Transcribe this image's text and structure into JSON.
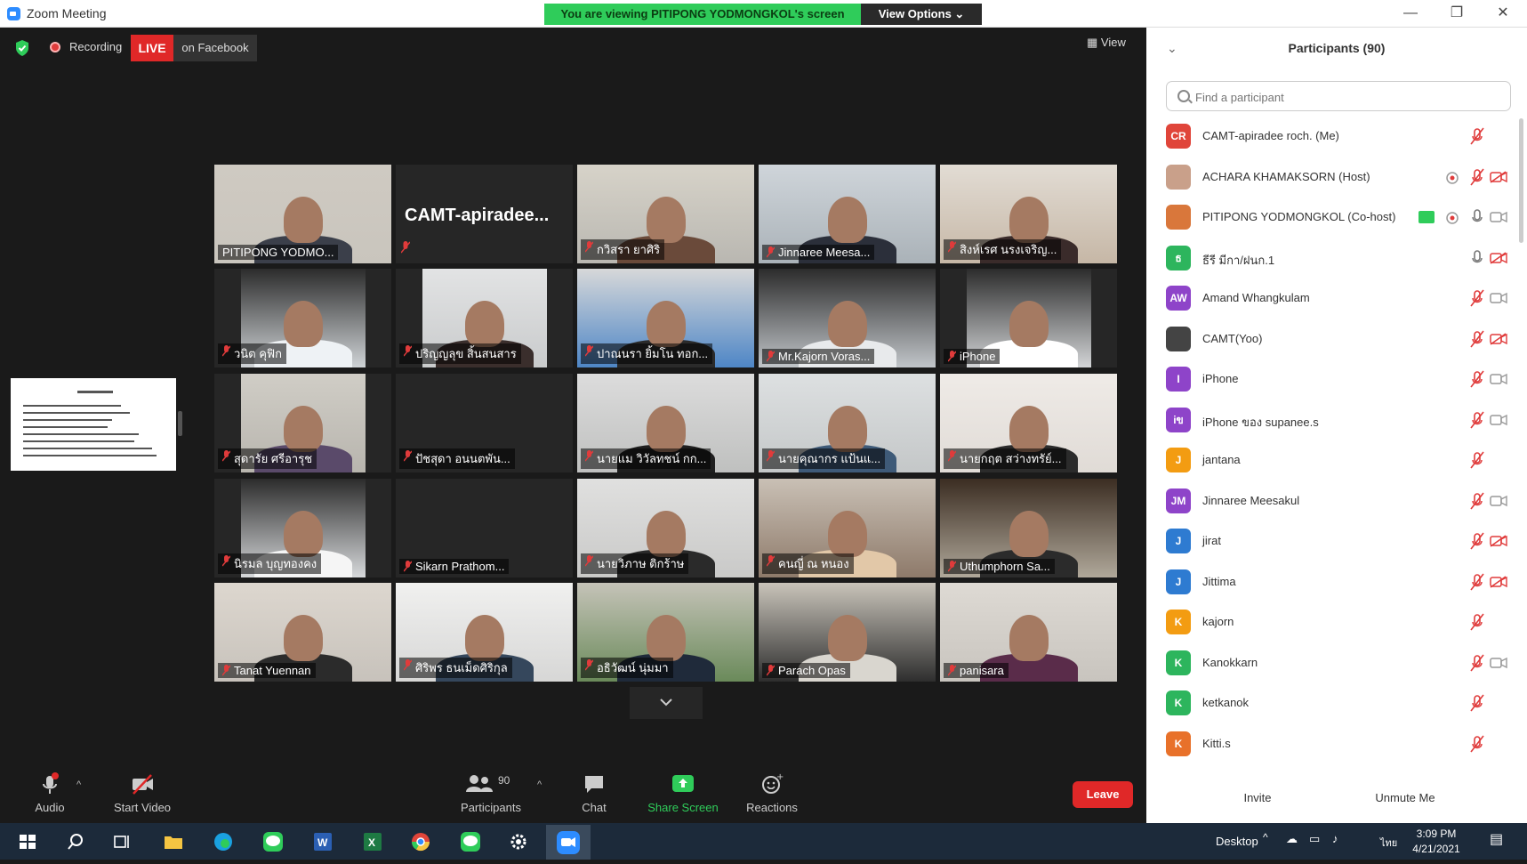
{
  "window": {
    "title": "Zoom Meeting",
    "viewing_banner": "You are viewing PITIPONG YODMONGKOL's screen",
    "view_options": "View Options ⌄",
    "minimize": "—",
    "restore": "❐",
    "close": "✕"
  },
  "topbar": {
    "recording": "Recording",
    "live": "LIVE",
    "live_on": "on Facebook",
    "view": "View"
  },
  "tiles": [
    {
      "name": "PITIPONG YODMO..."
    },
    {
      "name": "CAMT-apiradee..."
    },
    {
      "name": "กวิสรา ยาศิริ"
    },
    {
      "name": "Jinnaree Meesa..."
    },
    {
      "name": "สิงห์เรศ นรงเจริญ..."
    },
    {
      "name": "วนิต คุฟิก"
    },
    {
      "name": "ปริญญลุข สิ้นสนสาร"
    },
    {
      "name": "ปาณนรา ยิ้มโน ทอก..."
    },
    {
      "name": "Mr.Kajorn Voras..."
    },
    {
      "name": "iPhone"
    },
    {
      "name": "สุดารัย ศรีอารุช"
    },
    {
      "name": "ปัชสุดา อนนตพัน..."
    },
    {
      "name": "นายแม วิวัลทชน์ กก..."
    },
    {
      "name": "นายคุณากร แป้นแ..."
    },
    {
      "name": "นายกฤต สว่างทรัย์..."
    },
    {
      "name": "นิรมล บุญทองคง"
    },
    {
      "name": "Sikarn Prathom..."
    },
    {
      "name": "นายวิภาษ ติกร้าษ"
    },
    {
      "name": "คนญี่ ณ หนอง"
    },
    {
      "name": "Uthumphorn Sa..."
    },
    {
      "name": "Tanat Yuennan"
    },
    {
      "name": "ศิริพร ธนเม็ดศิริกุล"
    },
    {
      "name": "อธิวัฒน์ นุ่มมา"
    },
    {
      "name": "Parach Opas"
    },
    {
      "name": "panisara"
    }
  ],
  "toolbar": {
    "audio": "Audio",
    "start_video": "Start Video",
    "participants": "Participants",
    "participants_count": "90",
    "chat": "Chat",
    "share_screen": "Share Screen",
    "reactions": "Reactions",
    "leave": "Leave"
  },
  "panel": {
    "title": "Participants (90)",
    "search_placeholder": "Find a participant",
    "participants": [
      {
        "initials": "CR",
        "name": "CAMT-apiradee roch. (Me)",
        "color": "#e0453a"
      },
      {
        "initials": "",
        "name": "ACHARA KHAMAKSORN (Host)",
        "color": "#c9a08a"
      },
      {
        "initials": "",
        "name": "PITIPONG YODMONGKOL (Co-host)",
        "color": "#d9773b"
      },
      {
        "initials": "ธ",
        "name": "ธีรี มีกา/ฝนก.1",
        "color": "#2db55d"
      },
      {
        "initials": "AW",
        "name": "Amand Whangkulam",
        "color": "#8e44c9"
      },
      {
        "initials": "",
        "name": "CAMT(Yoo)",
        "color": "#444444"
      },
      {
        "initials": "I",
        "name": "iPhone",
        "color": "#8e44c9"
      },
      {
        "initials": "iข",
        "name": "iPhone ของ supanee.s",
        "color": "#8e44c9"
      },
      {
        "initials": "J",
        "name": "jantana",
        "color": "#f39c12"
      },
      {
        "initials": "JM",
        "name": "Jinnaree Meesakul",
        "color": "#8e44c9"
      },
      {
        "initials": "J",
        "name": "jirat",
        "color": "#2e7bd1"
      },
      {
        "initials": "J",
        "name": "Jittima",
        "color": "#2e7bd1"
      },
      {
        "initials": "K",
        "name": "kajorn",
        "color": "#f39c12"
      },
      {
        "initials": "K",
        "name": "Kanokkarn",
        "color": "#2db55d"
      },
      {
        "initials": "K",
        "name": "ketkanok",
        "color": "#2db55d"
      },
      {
        "initials": "K",
        "name": "Kitti.s",
        "color": "#e8712a"
      }
    ],
    "invite": "Invite",
    "unmute_me": "Unmute Me"
  },
  "taskbar": {
    "desktop": "Desktop",
    "time": "3:09 PM",
    "date": "4/21/2021",
    "lang": "ไทย"
  },
  "colors": {
    "accent": "#2d8cff",
    "live_red": "#e02828",
    "banner_green": "#2fcc5a",
    "active_speaker": "#d6e84a"
  }
}
